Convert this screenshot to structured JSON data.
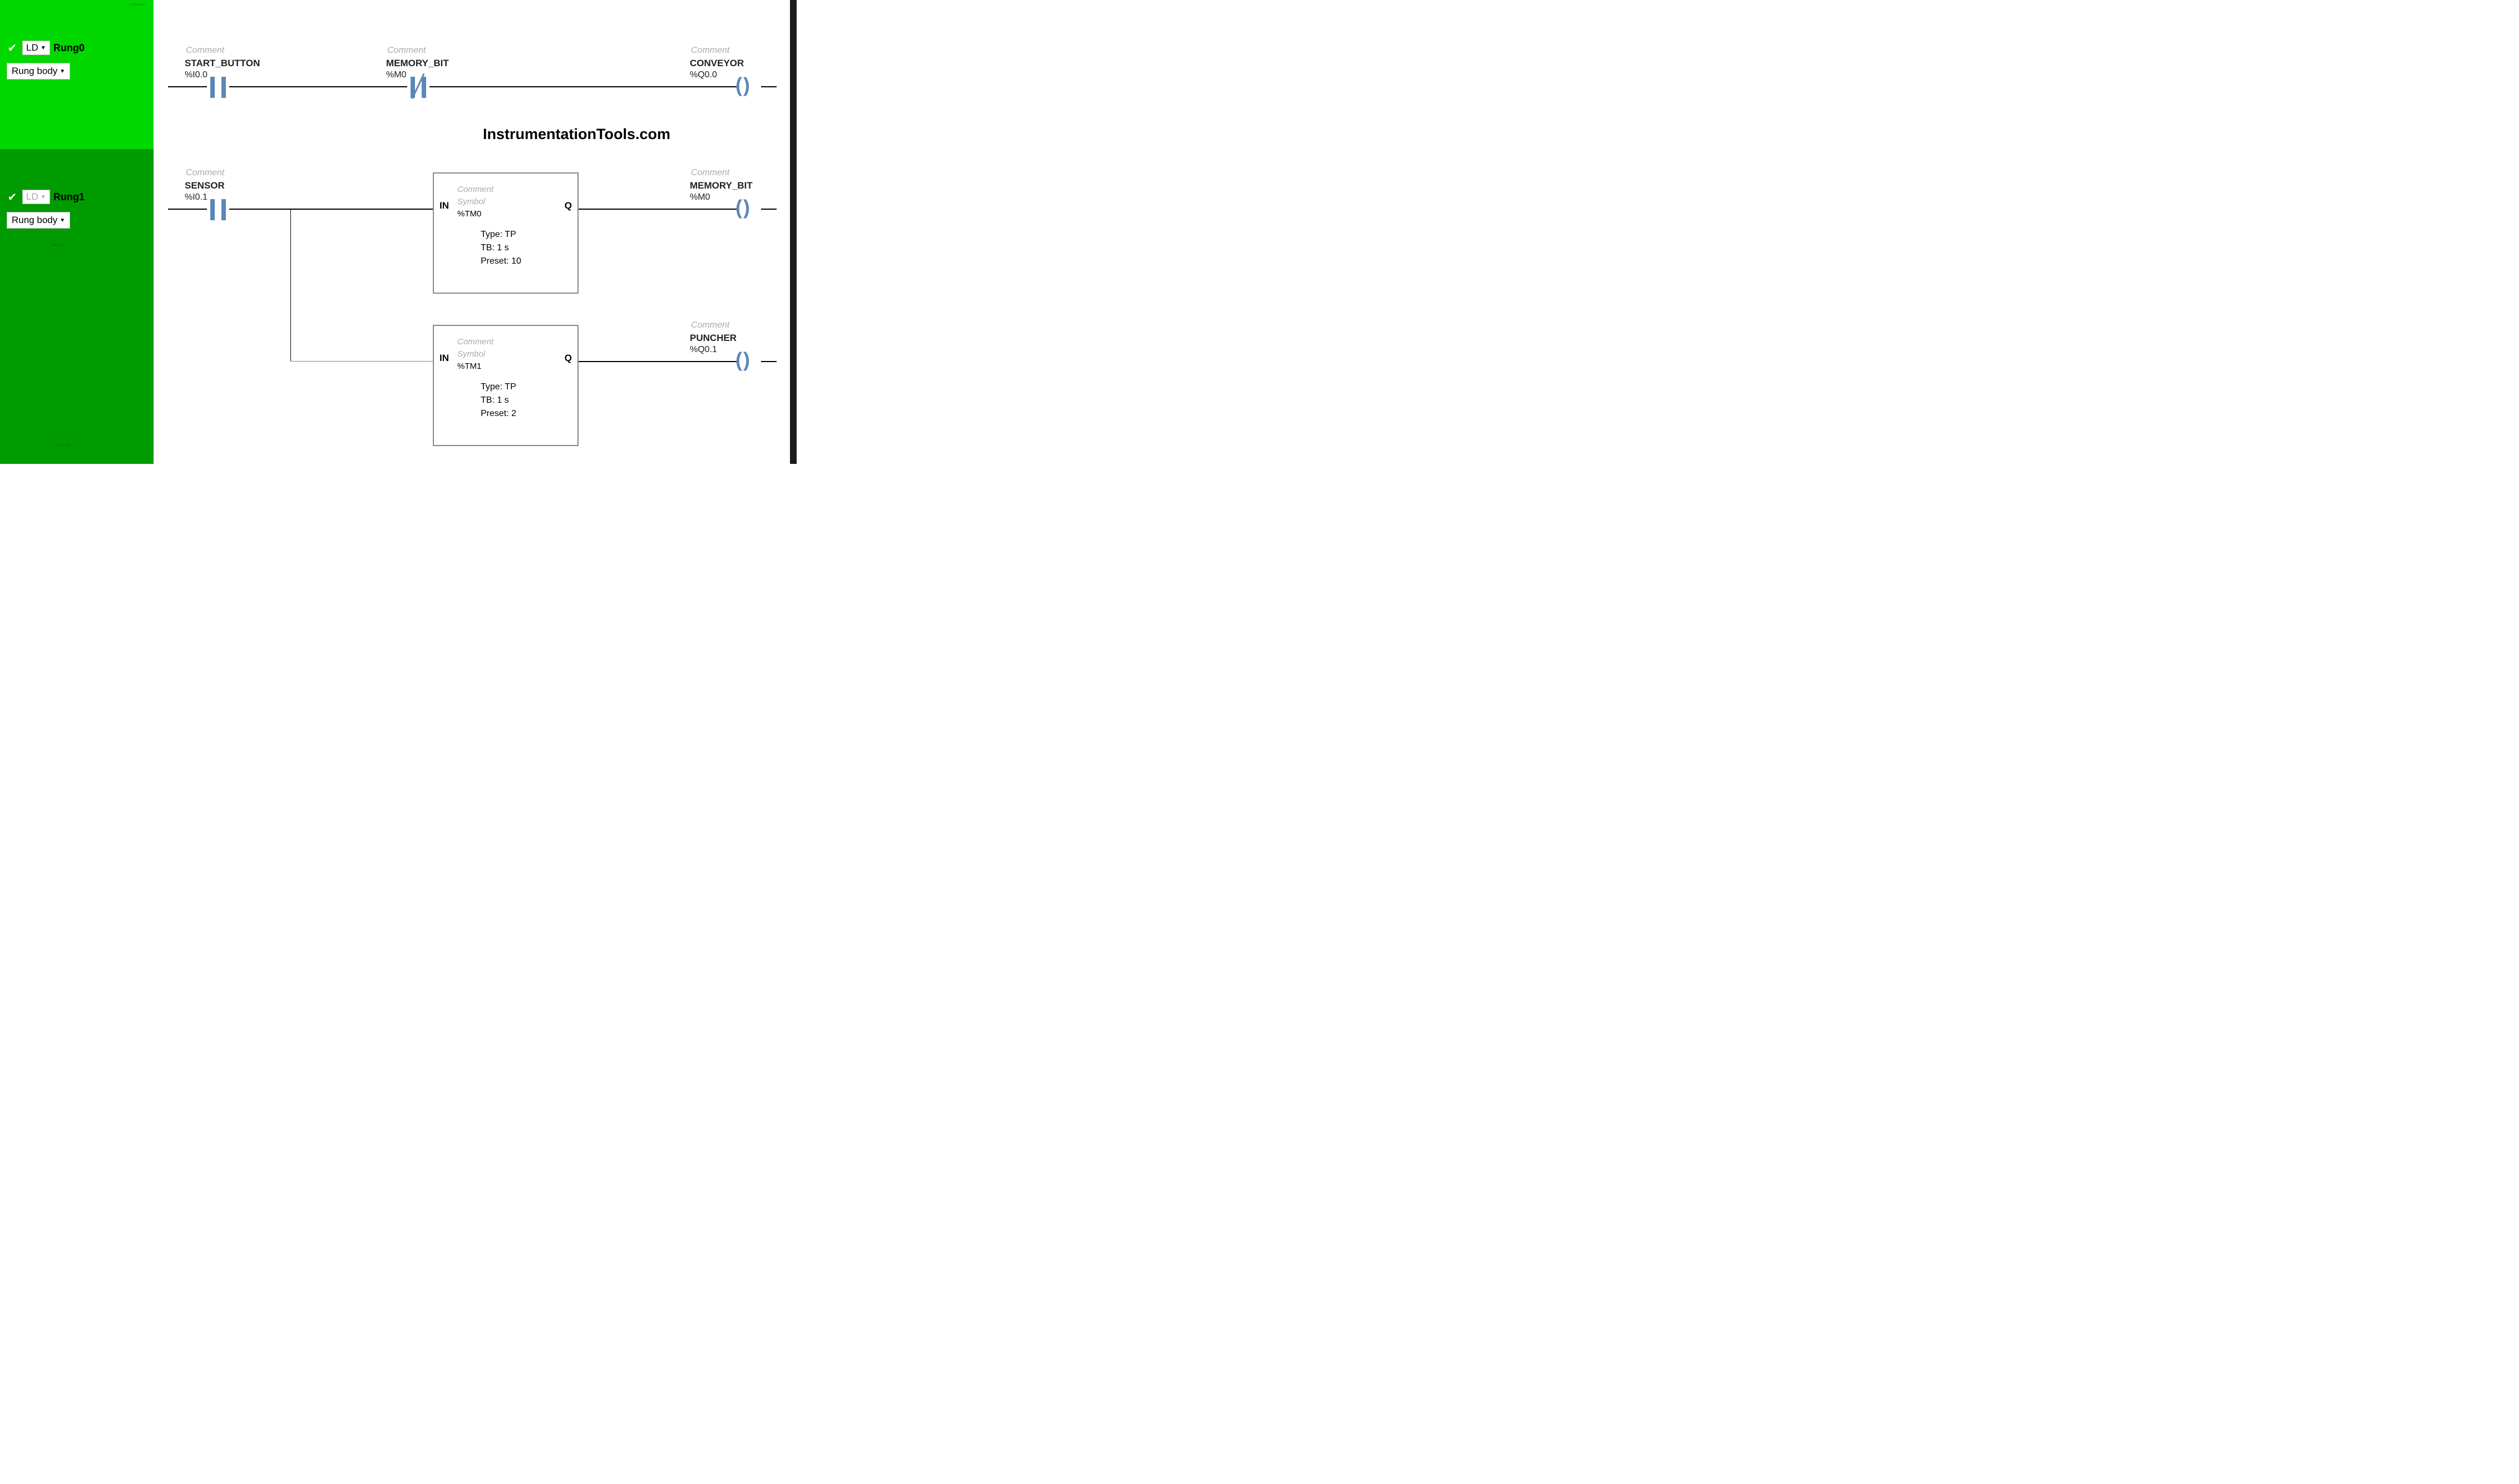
{
  "panel": {
    "check": "✔",
    "rung0": {
      "lang": "LD",
      "caret": "▼",
      "title": "Rung0",
      "body": "Rung body",
      "body_caret": "▼"
    },
    "rung1": {
      "lang": "LD",
      "caret": "▼",
      "title": "Rung1",
      "body": "Rung body",
      "body_caret": "▼"
    },
    "tiny1": "Comments",
    "tiny2": "See Tools",
    "tiny3": "See Tools"
  },
  "labels": {
    "comment": "Comment",
    "symbol": "Symbol"
  },
  "rung0": {
    "c1": {
      "symbol": "START_BUTTON",
      "addr": "%I0.0"
    },
    "c2": {
      "symbol": "MEMORY_BIT",
      "addr": "%M0"
    },
    "out": {
      "symbol": "CONVEYOR",
      "addr": "%Q0.0"
    }
  },
  "rung1": {
    "c1": {
      "symbol": "SENSOR",
      "addr": "%I0.1"
    },
    "tm0": {
      "addr": "%TM0",
      "in": "IN",
      "q": "Q",
      "type": "Type: TP",
      "tb": "TB: 1 s",
      "preset": "Preset: 10"
    },
    "tm1": {
      "addr": "%TM1",
      "in": "IN",
      "q": "Q",
      "type": "Type: TP",
      "tb": "TB: 1 s",
      "preset": "Preset: 2"
    },
    "out1": {
      "symbol": "MEMORY_BIT",
      "addr": "%M0"
    },
    "out2": {
      "symbol": "PUNCHER",
      "addr": "%Q0.1"
    }
  },
  "watermark": "InstrumentationTools.com",
  "coil": "( )"
}
